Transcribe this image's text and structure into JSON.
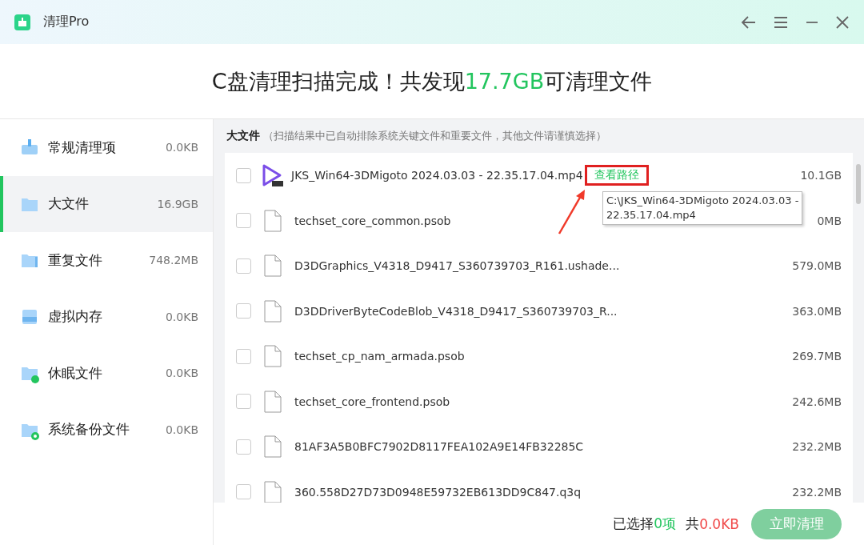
{
  "window": {
    "title": "清理Pro"
  },
  "headline": {
    "before": "C盘清理扫描完成！共发现",
    "amount": "17.7GB",
    "after": "可清理文件"
  },
  "sidebar": {
    "items": [
      {
        "kind": "broom",
        "label": "常规清理项",
        "size": "0.0KB",
        "selected": false
      },
      {
        "kind": "folder",
        "label": "大文件",
        "size": "16.9GB",
        "selected": true
      },
      {
        "kind": "folders",
        "label": "重复文件",
        "size": "748.2MB",
        "selected": false
      },
      {
        "kind": "disk",
        "label": "虚拟内存",
        "size": "0.0KB",
        "selected": false
      },
      {
        "kind": "sleep",
        "label": "休眠文件",
        "size": "0.0KB",
        "selected": false
      },
      {
        "kind": "backup",
        "label": "系统备份文件",
        "size": "0.0KB",
        "selected": false
      }
    ]
  },
  "section": {
    "title": "大文件",
    "note": "（扫描结果中已自动排除系统关键文件和重要文件，其他文件请谨慎选择）"
  },
  "files": [
    {
      "kind": "video",
      "name": "JKS_Win64-3DMigoto 2024.03.03 - 22.35.17.04.mp4",
      "link": "查看路径",
      "size": "10.1GB",
      "checked": false
    },
    {
      "kind": "file",
      "name": "techset_core_common.psob",
      "size": "0MB",
      "checked": false
    },
    {
      "kind": "file",
      "name": "D3DGraphics_V4318_D9417_S360739703_R161.ushade...",
      "size": "579.0MB",
      "checked": false
    },
    {
      "kind": "file",
      "name": "D3DDriverByteCodeBlob_V4318_D9417_S360739703_R...",
      "size": "363.0MB",
      "checked": false
    },
    {
      "kind": "file",
      "name": "techset_cp_nam_armada.psob",
      "size": "269.7MB",
      "checked": false
    },
    {
      "kind": "file",
      "name": "techset_core_frontend.psob",
      "size": "242.6MB",
      "checked": false
    },
    {
      "kind": "file",
      "name": "81AF3A5B0BFC7902D8117FEA102A9E14FB32285C",
      "size": "232.2MB",
      "checked": false
    },
    {
      "kind": "file",
      "name": "360.558D27D73D0948E59732EB613DD9C847.q3q",
      "size": "232.2MB",
      "checked": false
    }
  ],
  "tooltip": {
    "lines": [
      "C:\\JKS_Win64-3DMigoto 2024.03.03 -",
      "22.35.17.04.mp4"
    ]
  },
  "footer": {
    "selected_label": "已选择",
    "selected_count": "0项",
    "total_label": "共",
    "total": "0.0KB",
    "button": {
      "label": "立即清理",
      "disabled": true
    }
  }
}
